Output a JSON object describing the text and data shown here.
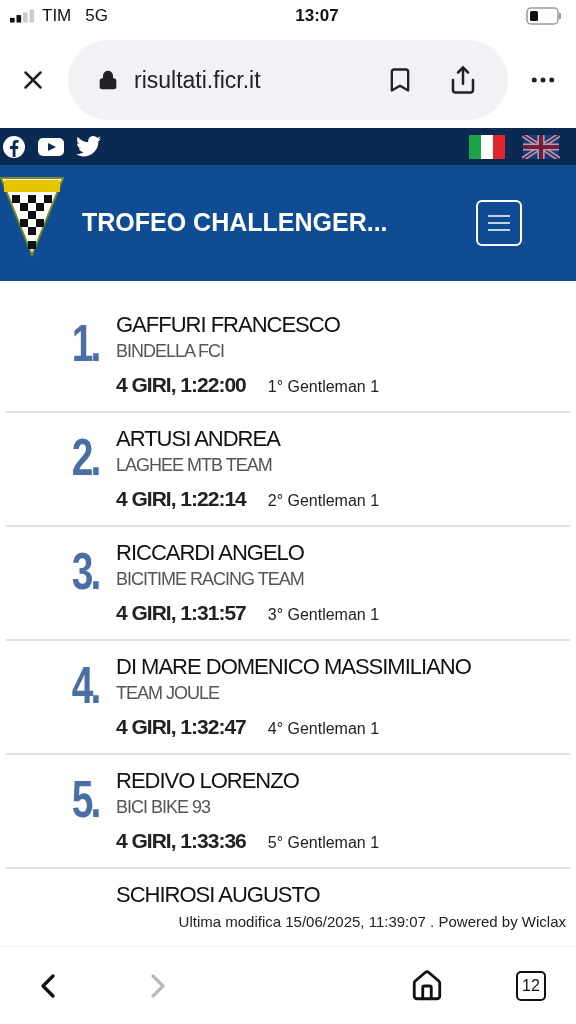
{
  "status_bar": {
    "carrier": "TIM",
    "network": "5G",
    "time": "13:07"
  },
  "address_bar": {
    "url": "risultati.ficr.it"
  },
  "header": {
    "title": "TROFEO CHALLENGER...",
    "languages": [
      {
        "kind": "italian",
        "selected": true
      },
      {
        "kind": "british",
        "selected": false
      }
    ]
  },
  "results": [
    {
      "rank": "1.",
      "name": "GAFFURI FRANCESCO",
      "team": "BINDELLA FCI",
      "time": "4 GIRI, 1:22:00",
      "category": "1° Gentleman 1"
    },
    {
      "rank": "2.",
      "name": "ARTUSI ANDREA",
      "team": "LAGHEE MTB TEAM",
      "time": "4 GIRI, 1:22:14",
      "category": "2° Gentleman 1"
    },
    {
      "rank": "3.",
      "name": "RICCARDI ANGELO",
      "team": "BICITIME RACING TEAM",
      "time": "4 GIRI, 1:31:57",
      "category": "3° Gentleman 1"
    },
    {
      "rank": "4.",
      "name": "DI MARE DOMENICO MASSIMILIANO",
      "team": "TEAM JOULE",
      "time": "4 GIRI, 1:32:47",
      "category": "4° Gentleman 1"
    },
    {
      "rank": "5.",
      "name": "REDIVO LORENZO",
      "team": "BICI BIKE 93",
      "time": "4 GIRI, 1:33:36",
      "category": "5° Gentleman 1"
    },
    {
      "name": "SCHIROSI AUGUSTO"
    }
  ],
  "footer": "Ultima modifica 15/06/2025, 11:39:07 . Powered by Wiclax",
  "bottom_bar": {
    "back_disabled": false,
    "forward_disabled": true,
    "tab_count": "12"
  }
}
